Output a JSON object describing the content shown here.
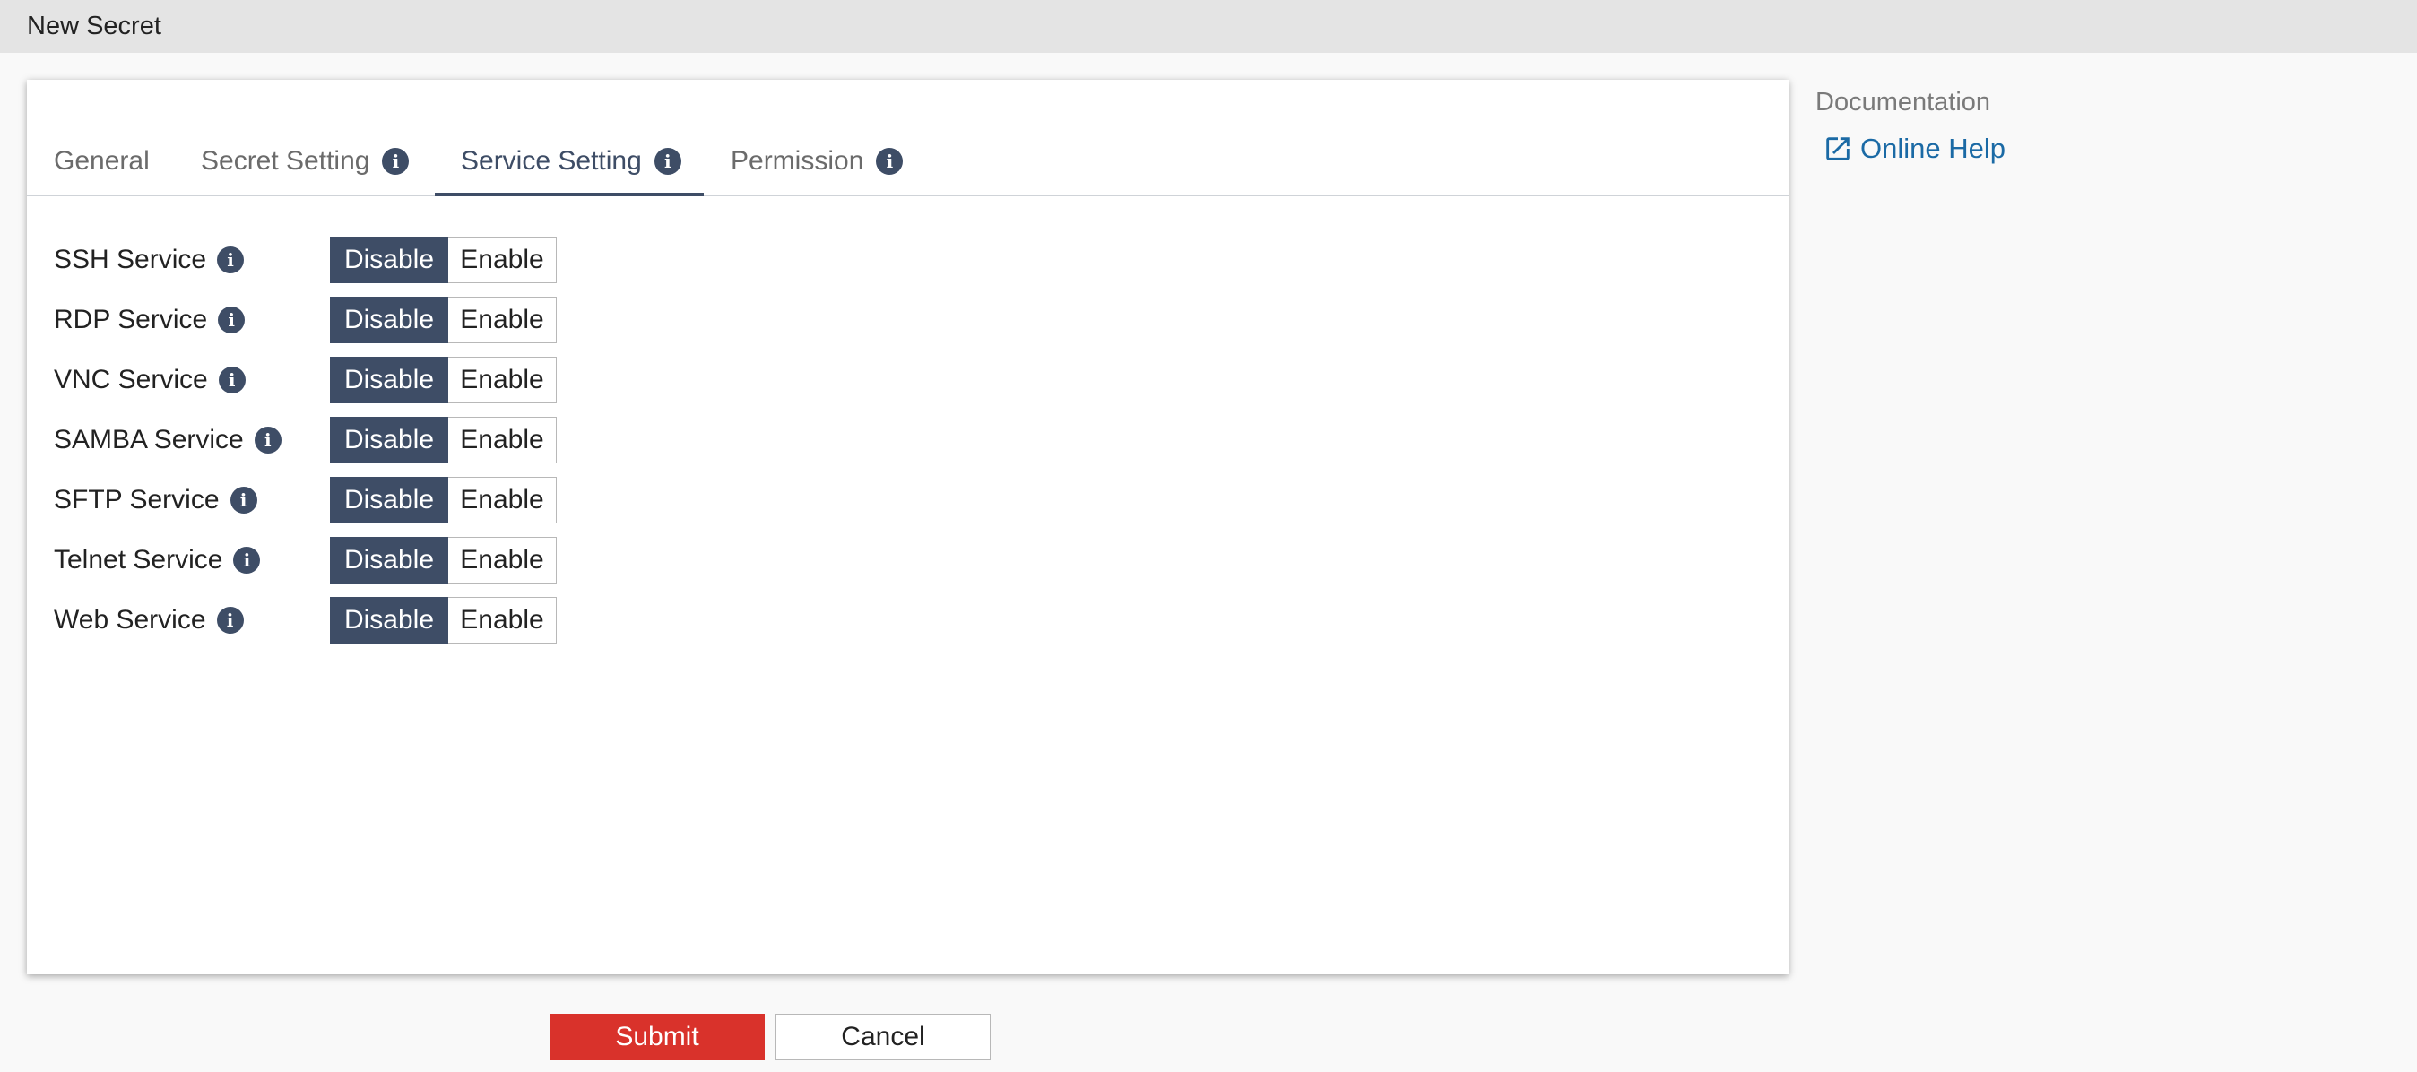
{
  "window": {
    "title": "New Secret"
  },
  "tabs": [
    {
      "label": "General",
      "has_info": false,
      "active": false
    },
    {
      "label": "Secret Setting",
      "has_info": true,
      "active": false
    },
    {
      "label": "Service Setting",
      "has_info": true,
      "active": true
    },
    {
      "label": "Permission",
      "has_info": true,
      "active": false
    }
  ],
  "services": [
    {
      "label": "SSH Service",
      "disable_label": "Disable",
      "enable_label": "Enable",
      "selected": "Disable"
    },
    {
      "label": "RDP Service",
      "disable_label": "Disable",
      "enable_label": "Enable",
      "selected": "Disable"
    },
    {
      "label": "VNC Service",
      "disable_label": "Disable",
      "enable_label": "Enable",
      "selected": "Disable"
    },
    {
      "label": "SAMBA Service",
      "disable_label": "Disable",
      "enable_label": "Enable",
      "selected": "Disable"
    },
    {
      "label": "SFTP Service",
      "disable_label": "Disable",
      "enable_label": "Enable",
      "selected": "Disable"
    },
    {
      "label": "Telnet Service",
      "disable_label": "Disable",
      "enable_label": "Enable",
      "selected": "Disable"
    },
    {
      "label": "Web Service",
      "disable_label": "Disable",
      "enable_label": "Enable",
      "selected": "Disable"
    }
  ],
  "documentation": {
    "heading": "Documentation",
    "link_label": "Online Help",
    "link_icon": "external-link-icon"
  },
  "actions": {
    "submit_label": "Submit",
    "cancel_label": "Cancel"
  },
  "icons": {
    "info": "i"
  },
  "colors": {
    "accent": "#3e4d66",
    "submit": "#d9322b",
    "link": "#1b6aa5"
  }
}
